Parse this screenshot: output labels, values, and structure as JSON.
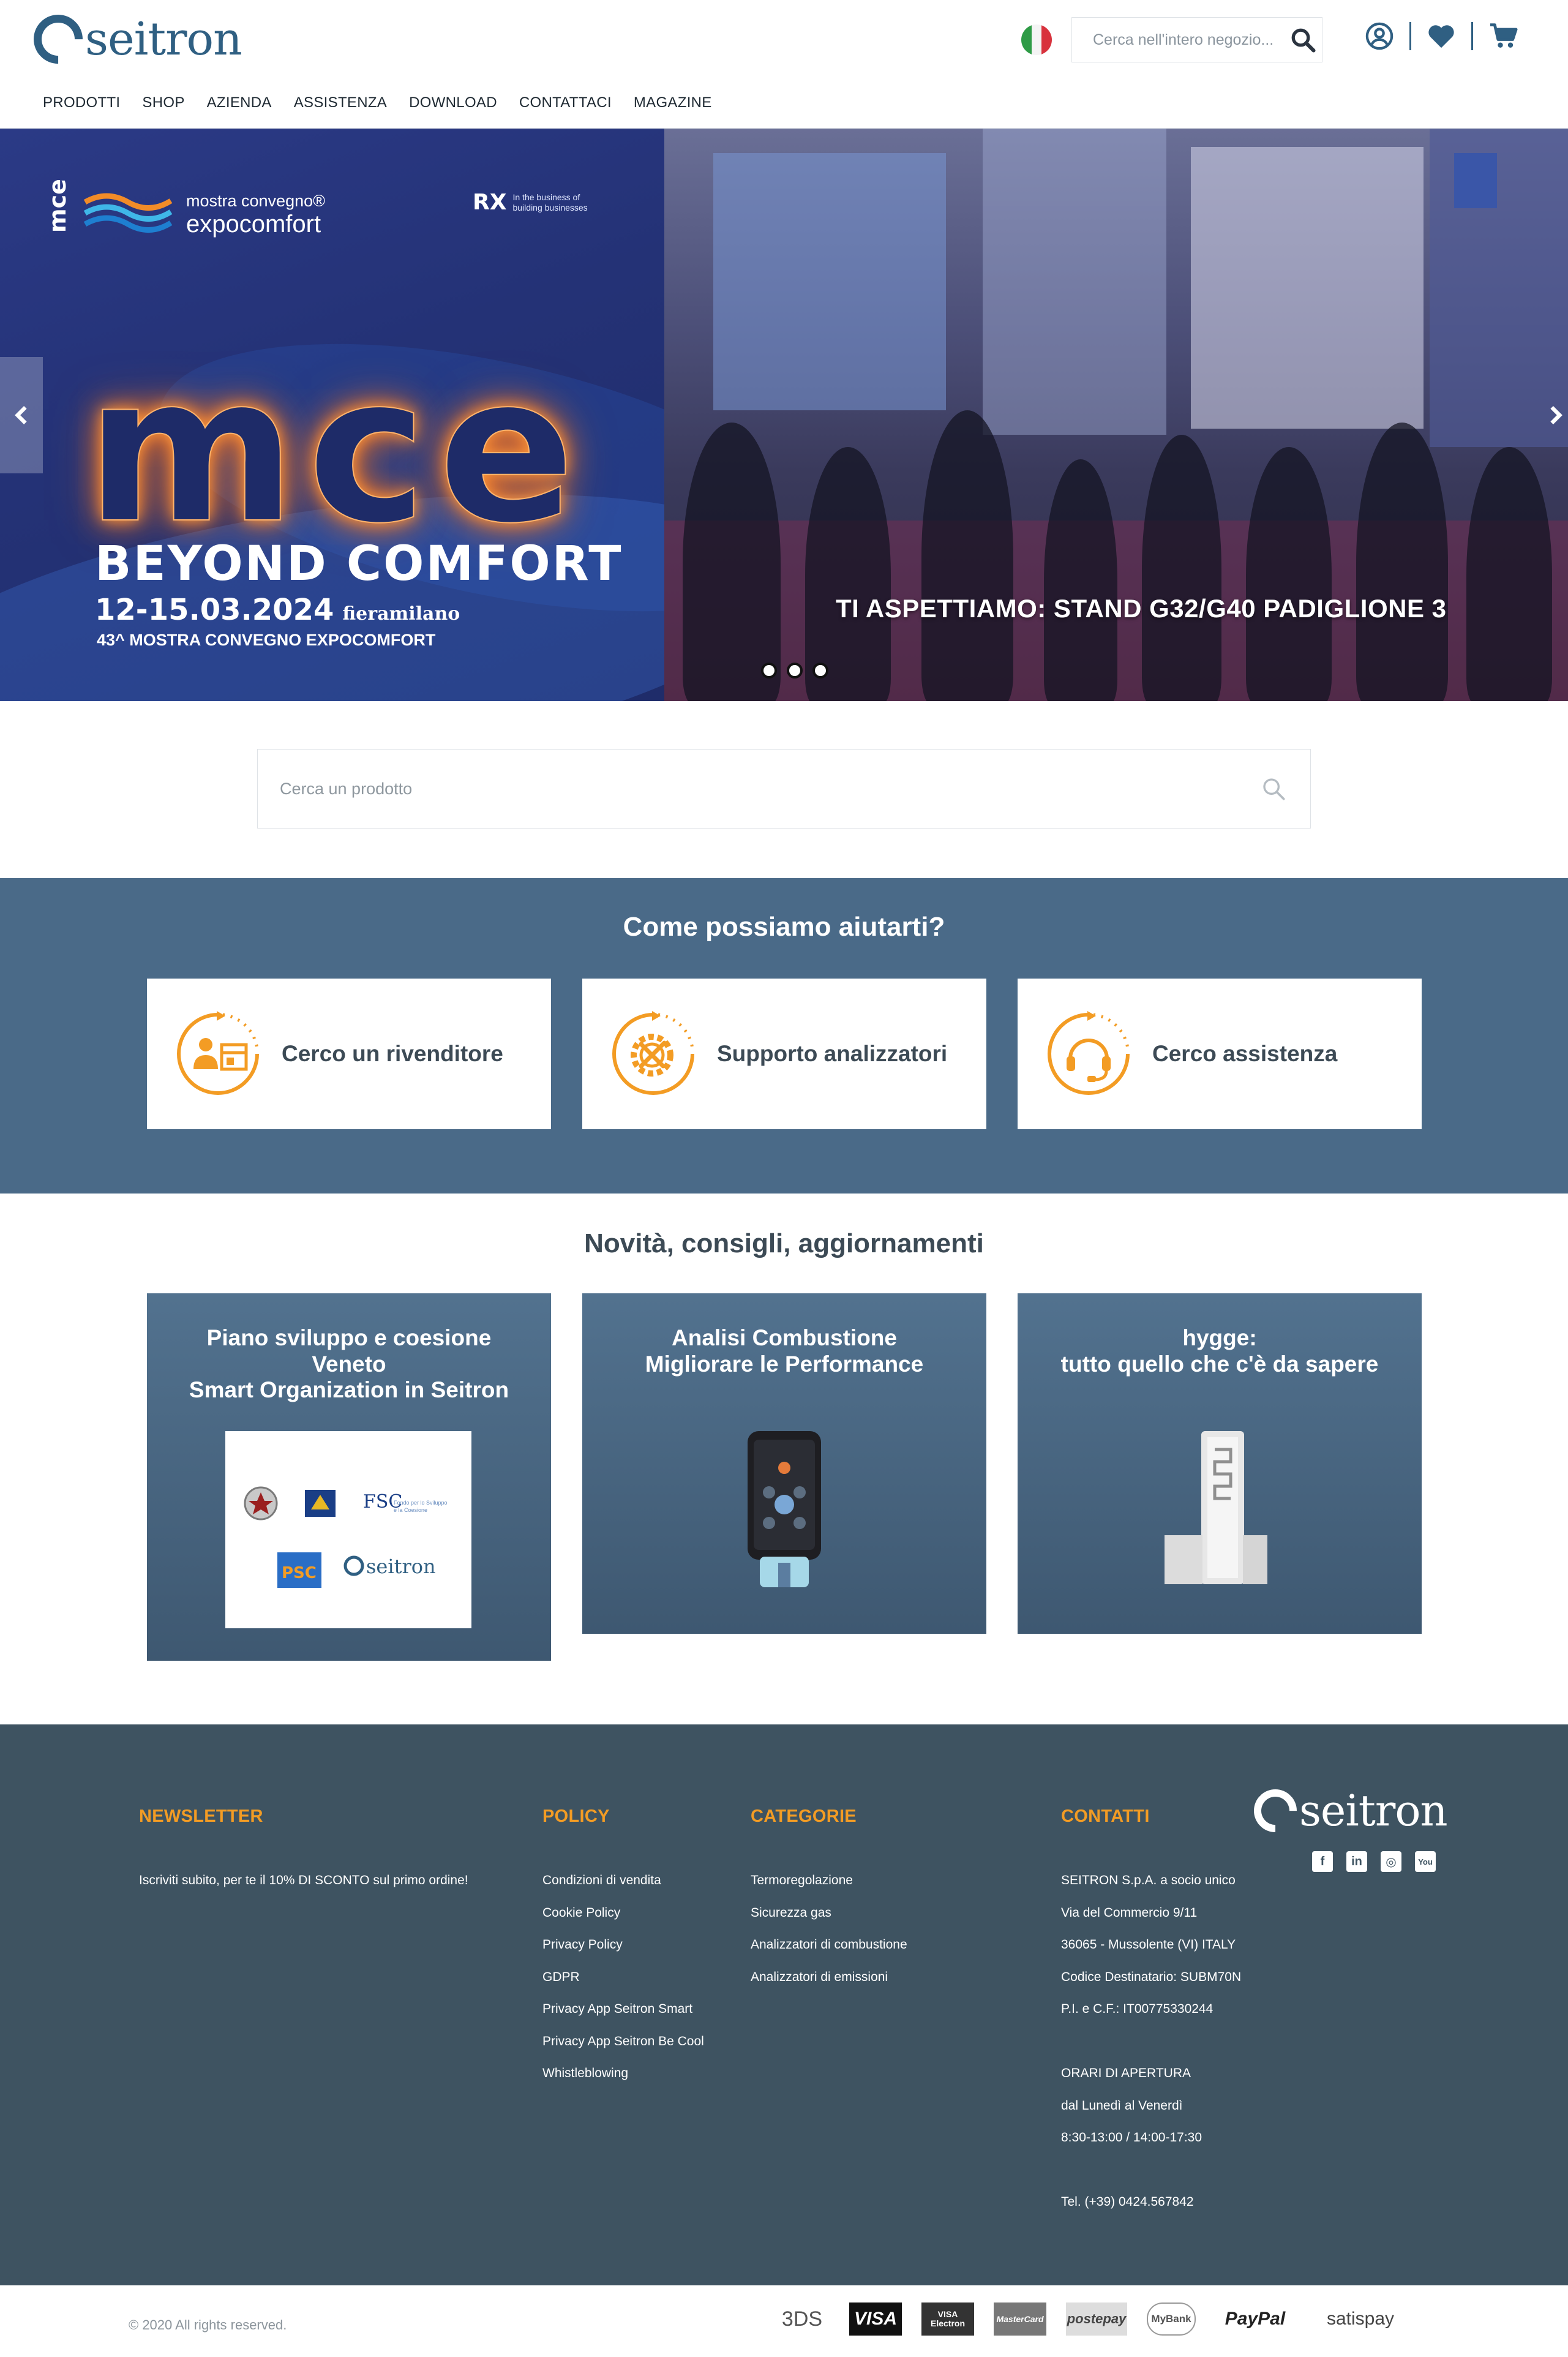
{
  "header": {
    "logo_text": "seitron",
    "search_placeholder": "Cerca nell'intero negozio...",
    "nav": [
      "PRODOTTI",
      "SHOP",
      "AZIENDA",
      "ASSISTENZA",
      "DOWNLOAD",
      "CONTATTACI",
      "MAGAZINE"
    ],
    "icons": [
      "italian-flag-icon",
      "search-icon",
      "user-icon",
      "heart-icon",
      "cart-icon"
    ]
  },
  "hero": {
    "mce_vertical": "mce",
    "event_line1": "mostra convegno®",
    "event_line2": "expocomfort",
    "rx_mark": "RX",
    "rx_text1": "In the business of",
    "rx_text2": "building businesses",
    "big_text": "mce",
    "tagline": "BEYOND COMFORT",
    "dates": "12-15.03.2024",
    "venue": "fieramilano",
    "edition": "43^ MOSTRA CONVEGNO EXPOCOMFORT",
    "stand_text": "TI ASPETTIAMO: STAND G32/G40 PADIGLIONE 3",
    "slide_count": 3
  },
  "product_search": {
    "placeholder": "Cerca un prodotto"
  },
  "help": {
    "title": "Come possiamo aiutarti?",
    "cards": [
      {
        "label": "Cerco un rivenditore",
        "icon": "dealer-icon"
      },
      {
        "label": "Supporto analizzatori",
        "icon": "tools-gear-icon"
      },
      {
        "label": "Cerco assistenza",
        "icon": "headset-icon"
      }
    ]
  },
  "news": {
    "title": "Novità, consigli, aggiornamenti",
    "cards": [
      {
        "lines": [
          "Piano sviluppo e coesione",
          "Veneto",
          "Smart Organization in Seitron"
        ],
        "logos": [
          "FSC",
          "PSC",
          "seitron"
        ]
      },
      {
        "lines": [
          "Analisi Combustione",
          "Migliorare le Performance"
        ]
      },
      {
        "lines": [
          "hygge:",
          "tutto quello che c'è da sapere"
        ]
      }
    ]
  },
  "footer": {
    "newsletter": {
      "title": "NEWSLETTER",
      "text": "Iscriviti subito, per te il 10% DI SCONTO sul primo ordine!"
    },
    "policy": {
      "title": "POLICY",
      "links": [
        "Condizioni di vendita",
        "Cookie Policy",
        "Privacy Policy",
        "GDPR",
        "Privacy App Seitron Smart",
        "Privacy App Seitron Be Cool",
        "Whistleblowing"
      ]
    },
    "categorie": {
      "title": "CATEGORIE",
      "links": [
        "Termoregolazione",
        "Sicurezza gas",
        "Analizzatori di combustione",
        "Analizzatori di emissioni"
      ]
    },
    "contatti": {
      "title": "CONTATTI",
      "lines": [
        "SEITRON S.p.A. a socio unico",
        "Via del Commercio 9/11",
        "36065 - Mussolente (VI) ITALY",
        "Codice Destinatario: SUBM70N",
        "P.I. e C.F.: IT00775330244",
        "",
        "ORARI DI APERTURA",
        "dal Lunedì al Venerdì",
        "8:30-13:00 / 14:00-17:30",
        "",
        "Tel. (+39) 0424.567842"
      ]
    },
    "logo_text": "seitron",
    "socials": [
      "facebook-icon",
      "linkedin-icon",
      "instagram-icon",
      "youtube-icon"
    ],
    "social_glyphs": [
      "f",
      "in",
      "◎",
      "You"
    ],
    "copyright": "© 2020 All rights reserved.",
    "payments": [
      "3DS",
      "VISA",
      "VISA Electron",
      "MasterCard",
      "postepay",
      "MyBank",
      "PayPal",
      "satispay"
    ]
  },
  "colors": {
    "brand_blue": "#2f5f82",
    "help_bg": "#4a6a88",
    "footer_bg": "#3e5361",
    "accent_orange": "#f39c24"
  }
}
